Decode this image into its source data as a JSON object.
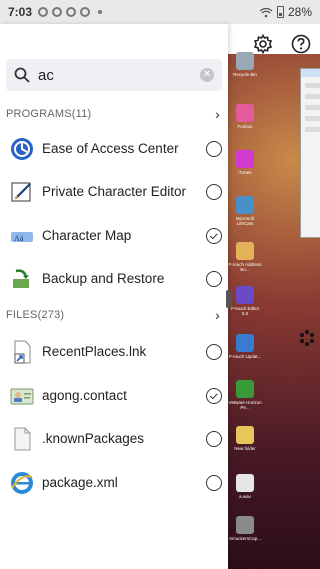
{
  "status_bar": {
    "time": "7:03",
    "battery": "28%"
  },
  "search": {
    "value": "ac"
  },
  "programs": {
    "header": "PROGRAMS(11)",
    "items": [
      {
        "label": "Ease of Access Center",
        "checked": false,
        "icon": "ease-of-access-icon"
      },
      {
        "label": "Private Character Editor",
        "checked": false,
        "icon": "private-character-editor-icon"
      },
      {
        "label": "Character Map",
        "checked": true,
        "icon": "character-map-icon"
      },
      {
        "label": "Backup and Restore",
        "checked": false,
        "icon": "backup-restore-icon"
      }
    ]
  },
  "files": {
    "header": "FILES(273)",
    "items": [
      {
        "label": "RecentPlaces.lnk",
        "checked": false,
        "icon": "shortcut-file-icon"
      },
      {
        "label": "agong.contact",
        "checked": true,
        "icon": "contact-file-icon"
      },
      {
        "label": ".knownPackages",
        "checked": false,
        "icon": "document-file-icon"
      },
      {
        "label": "package.xml",
        "checked": false,
        "icon": "ie-file-icon"
      }
    ]
  },
  "desktop_icons": [
    {
      "label": "Recycle Bin",
      "color": "#9aa8b6"
    },
    {
      "label": "Funbox",
      "color": "#e25c9b"
    },
    {
      "label": "iTunes",
      "color": "#d23ad0"
    },
    {
      "label": "Microsoft LifeCam",
      "color": "#4a90c8"
    },
    {
      "label": "P-touch Address Bo...",
      "color": "#e3b35a"
    },
    {
      "label": "P-touch Editor 5.0",
      "color": "#6a4ac8"
    },
    {
      "label": "P-touch Updat...",
      "color": "#3a7ad0"
    },
    {
      "label": "VMware Horizon Pe...",
      "color": "#3a9a3a"
    },
    {
      "label": "New folder",
      "color": "#e8c65a"
    },
    {
      "label": "a.wav",
      "color": "#e6e6e6"
    },
    {
      "label": "SmuckersCap...",
      "color": "#8a8a8a"
    }
  ]
}
